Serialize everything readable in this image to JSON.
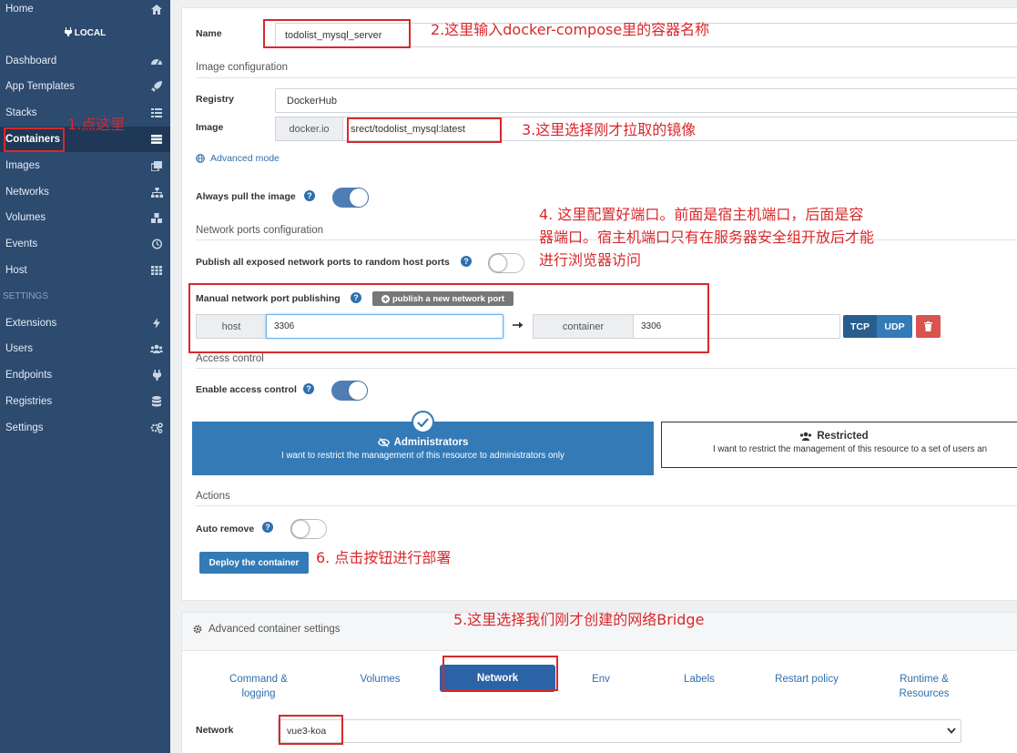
{
  "sidebar": {
    "top_item": "Home",
    "local_label": "LOCAL",
    "settings_section": "SETTINGS",
    "items": [
      {
        "label": "Dashboard",
        "icon": "tachometer-icon"
      },
      {
        "label": "App Templates",
        "icon": "rocket-icon"
      },
      {
        "label": "Stacks",
        "icon": "list-icon"
      },
      {
        "label": "Containers",
        "icon": "server-icon"
      },
      {
        "label": "Images",
        "icon": "clone-icon"
      },
      {
        "label": "Networks",
        "icon": "sitemap-icon"
      },
      {
        "label": "Volumes",
        "icon": "cubes-icon"
      },
      {
        "label": "Events",
        "icon": "history-icon"
      },
      {
        "label": "Host",
        "icon": "grid-icon"
      }
    ],
    "settings_items": [
      {
        "label": "Extensions",
        "icon": "bolt-icon"
      },
      {
        "label": "Users",
        "icon": "users-icon"
      },
      {
        "label": "Endpoints",
        "icon": "plug-icon"
      },
      {
        "label": "Registries",
        "icon": "database-icon"
      },
      {
        "label": "Settings",
        "icon": "cogs-icon"
      }
    ]
  },
  "form": {
    "name_label": "Name",
    "name_value": "todolist_mysql_server",
    "image_config_title": "Image configuration",
    "registry_label": "Registry",
    "registry_value": "DockerHub",
    "image_label": "Image",
    "image_prefix": "docker.io",
    "image_value": "srect/todolist_mysql:latest",
    "advanced_mode": "Advanced mode",
    "always_pull_label": "Always pull the image",
    "always_pull": true,
    "network_ports_title": "Network ports configuration",
    "publish_all_label": "Publish all exposed network ports to random host ports",
    "publish_all": false,
    "manual_publish_label": "Manual network port publishing",
    "publish_new_button": "publish a new network port",
    "host_addon": "host",
    "host_port": "3306",
    "container_addon": "container",
    "container_port": "3306",
    "tcp_label": "TCP",
    "udp_label": "UDP",
    "access_control_title": "Access control",
    "enable_access_label": "Enable access control",
    "enable_access": true,
    "admin_title": "Administrators",
    "admin_desc": "I want to restrict the management of this resource to administrators only",
    "restricted_title": "Restricted",
    "restricted_desc": "I want to restrict the management of this resource to a set of users an",
    "actions_title": "Actions",
    "auto_remove_label": "Auto remove",
    "auto_remove": false,
    "deploy_button": "Deploy the container"
  },
  "advanced": {
    "title": "Advanced container settings",
    "tabs": [
      {
        "label": "Command &\nlogging"
      },
      {
        "label": "Volumes"
      },
      {
        "label": "Network"
      },
      {
        "label": "Env"
      },
      {
        "label": "Labels"
      },
      {
        "label": "Restart policy"
      },
      {
        "label": "Runtime &\nResources"
      }
    ],
    "active_tab": "Network",
    "network_label": "Network",
    "network_value": "vue3-koa"
  },
  "annotations": {
    "a1": "1.点这里",
    "a2": "2.这里输入docker-compose里的容器名称",
    "a3": "3.这里选择刚才拉取的镜像",
    "a4_line1": "4. 这里配置好端口。前面是宿主机端口，后面是容",
    "a4_line2": "器端口。宿主机端口只有在服务器安全组开放后才能",
    "a4_line3": "进行浏览器访问",
    "a5": "5.这里选择我们刚才创建的网络Bridge",
    "a6": "6. 点击按钮进行部署"
  },
  "colors": {
    "sidebar_bg": "#2d4a6f",
    "primary": "#337ab7",
    "active_tab": "#2a63a6",
    "danger": "#d9534f",
    "annotation": "#d9282b"
  }
}
